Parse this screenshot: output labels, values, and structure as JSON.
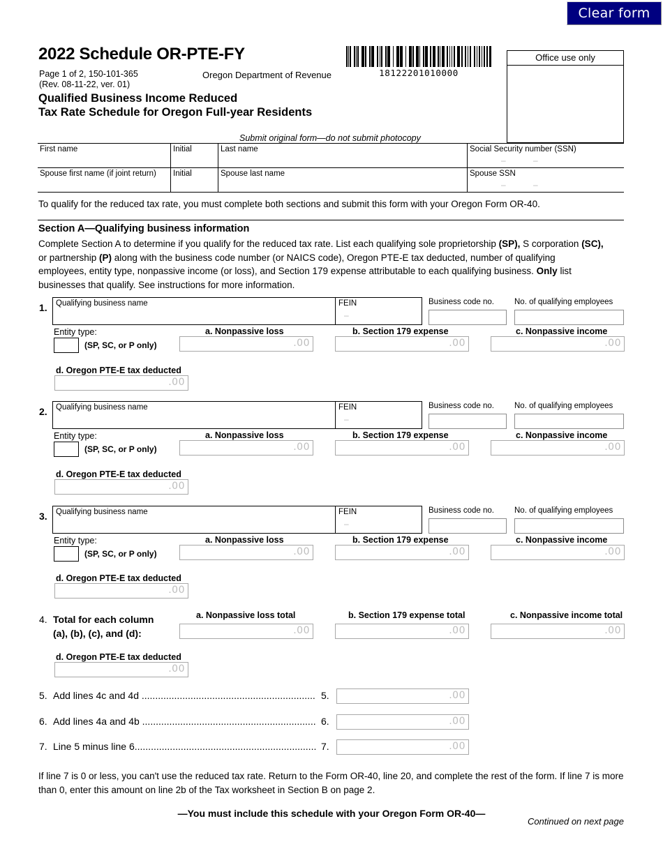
{
  "toolbar": {
    "clear_form_label": "Clear form"
  },
  "header": {
    "title": "2022 Schedule OR-PTE-FY",
    "page_line": "Page 1 of 2, 150-101-365",
    "rev_line": "(Rev. 08-11-22, ver. 01)",
    "department": "Oregon Department of Revenue",
    "subtitle_line1": "Qualified Business Income Reduced",
    "subtitle_line2": "Tax Rate Schedule for Oregon Full-year Residents",
    "barcode_number": "18122201010000",
    "office_use_label": "Office use only",
    "submit_note": "Submit original form—do not submit photocopy"
  },
  "name_table": {
    "rows": [
      {
        "first_name": "First name",
        "initial": "Initial",
        "last_name": "Last name",
        "ssn": "Social Security number (SSN)"
      },
      {
        "first_name": "Spouse first name (if joint return)",
        "initial": "Initial",
        "last_name": "Spouse last name",
        "ssn": "Spouse SSN"
      }
    ]
  },
  "qualify_note": "To qualify for the reduced tax rate, you must complete both sections and submit this form with your Oregon Form OR-40.",
  "section_a": {
    "title": "Section A—Qualifying business information",
    "body_part1": "Complete Section A to determine if you qualify for the reduced tax rate. List each qualifying sole proprietorship ",
    "body_sp": "(SP),",
    "body_part2": " S corporation ",
    "body_sc": "(SC),",
    "body_part3": " or partnership ",
    "body_p": "(P)",
    "body_part4": " along with the business code number (or NAICS code), Oregon PTE-E tax deducted, number of qualifying employees, entity type, nonpassive income (or loss), and Section 179 expense attributable to each qualifying business. ",
    "body_only": "Only",
    "body_part5": " list businesses that qualify. See instructions for more information."
  },
  "labels": {
    "qualifying_business_name": "Qualifying business name",
    "fein": "FEIN",
    "business_code_no": "Business code no.",
    "no_of_qualifying_employees": "No. of qualifying employees",
    "entity_type": "Entity type:",
    "entity_note": "(SP, SC, or P only)",
    "col_a": "a. Nonpassive loss",
    "col_b": "b. Section 179 expense",
    "col_c": "c. Nonpassive income",
    "col_d": "d. Oregon PTE-E tax deducted",
    "cents": ".00"
  },
  "businesses": [
    {
      "number": "1."
    },
    {
      "number": "2."
    },
    {
      "number": "3."
    }
  ],
  "line4": {
    "number": "4.",
    "text_line1": "Total for each column",
    "text_line2": "(a), (b), (c), and (d):",
    "col_a": "a. Nonpassive loss total",
    "col_b": "b. Section 179 expense total",
    "col_c": "c. Nonpassive income total",
    "col_d": "d. Oregon PTE-E tax deducted"
  },
  "calc_lines": [
    {
      "number": "5.",
      "text": "Add lines 4c and 4d ................................................................",
      "ref": "5."
    },
    {
      "number": "6.",
      "text": "Add lines 4a and 4b ................................................................",
      "ref": "6."
    },
    {
      "number": "7.",
      "text": "Line 5 minus line 6...................................................................",
      "ref": "7."
    }
  ],
  "footer": {
    "note": "If line 7 is 0 or less, you can't use the reduced tax rate. Return to the Form OR-40, line 20, and complete the rest of the form. If line 7 is more than 0, enter this amount on line 2b of the Tax worksheet in Section B on page 2.",
    "include_note": "—You must include this schedule with your Oregon Form OR-40—",
    "continued": "Continued on next page"
  },
  "colors": {
    "button_bg": "#000080",
    "button_text": "#ffffff",
    "field_border": "#a8a8a8",
    "cents_gray": "#bdbdbd"
  }
}
